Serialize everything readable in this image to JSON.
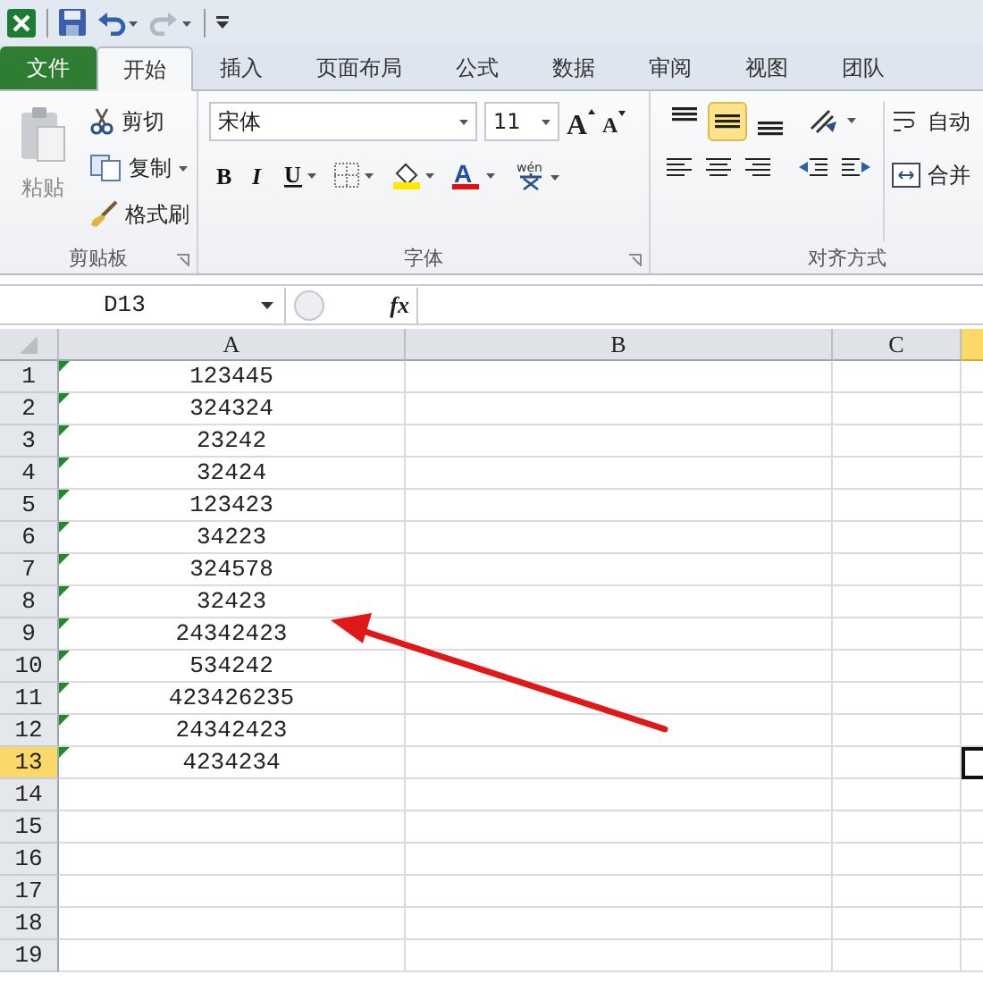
{
  "tabs": [
    {
      "label": "文件",
      "kind": "file",
      "selected": false
    },
    {
      "label": "开始",
      "kind": "tab",
      "selected": true
    },
    {
      "label": "插入",
      "kind": "tab",
      "selected": false
    },
    {
      "label": "页面布局",
      "kind": "tab",
      "selected": false
    },
    {
      "label": "公式",
      "kind": "tab",
      "selected": false
    },
    {
      "label": "数据",
      "kind": "tab",
      "selected": false
    },
    {
      "label": "审阅",
      "kind": "tab",
      "selected": false
    },
    {
      "label": "视图",
      "kind": "tab",
      "selected": false
    },
    {
      "label": "团队",
      "kind": "tab",
      "selected": false
    }
  ],
  "ribbon": {
    "clipboard": {
      "paste": "粘贴",
      "cut": "剪切",
      "copy": "复制",
      "format_painter": "格式刷",
      "label": "剪贴板"
    },
    "font": {
      "font_name": "宋体",
      "font_size": "11",
      "grow": "A",
      "shrink": "A",
      "bold": "B",
      "italic": "I",
      "underline": "U",
      "font_color": "A",
      "phonetic": "wén",
      "label": "字体"
    },
    "alignment": {
      "vertical": [
        {
          "kind": "top",
          "selected": false
        },
        {
          "kind": "middle",
          "selected": true
        },
        {
          "kind": "bottom",
          "selected": false
        }
      ],
      "wrap_text": "自动",
      "merge": "合并",
      "label": "对齐方式"
    }
  },
  "name_box": "D13",
  "function_label": "fx",
  "columns": [
    {
      "label": "A",
      "selected": false
    },
    {
      "label": "B",
      "selected": false
    },
    {
      "label": "C",
      "selected": false
    },
    {
      "selected": true
    }
  ],
  "rows": [
    {
      "number": "1",
      "a": "123445",
      "text_flag": true,
      "selected": false
    },
    {
      "number": "2",
      "a": "324324",
      "text_flag": true,
      "selected": false
    },
    {
      "number": "3",
      "a": "23242",
      "text_flag": true,
      "selected": false
    },
    {
      "number": "4",
      "a": "32424",
      "text_flag": true,
      "selected": false
    },
    {
      "number": "5",
      "a": "123423",
      "text_flag": true,
      "selected": false
    },
    {
      "number": "6",
      "a": "34223",
      "text_flag": true,
      "selected": false
    },
    {
      "number": "7",
      "a": "324578",
      "text_flag": true,
      "selected": false
    },
    {
      "number": "8",
      "a": "32423",
      "text_flag": true,
      "selected": false
    },
    {
      "number": "9",
      "a": "24342423",
      "text_flag": true,
      "selected": false
    },
    {
      "number": "10",
      "a": "534242",
      "text_flag": true,
      "selected": false
    },
    {
      "number": "11",
      "a": "423426235",
      "text_flag": true,
      "selected": false
    },
    {
      "number": "12",
      "a": "24342423",
      "text_flag": true,
      "selected": false
    },
    {
      "number": "13",
      "a": "4234234",
      "text_flag": true,
      "selected": true
    },
    {
      "number": "14",
      "text_flag": false,
      "selected": false
    },
    {
      "number": "15",
      "text_flag": false,
      "selected": false
    },
    {
      "number": "16",
      "text_flag": false,
      "selected": false
    },
    {
      "number": "17",
      "text_flag": false,
      "selected": false
    },
    {
      "number": "18",
      "text_flag": false,
      "selected": false
    },
    {
      "number": "19",
      "text_flag": false,
      "selected": false
    }
  ]
}
